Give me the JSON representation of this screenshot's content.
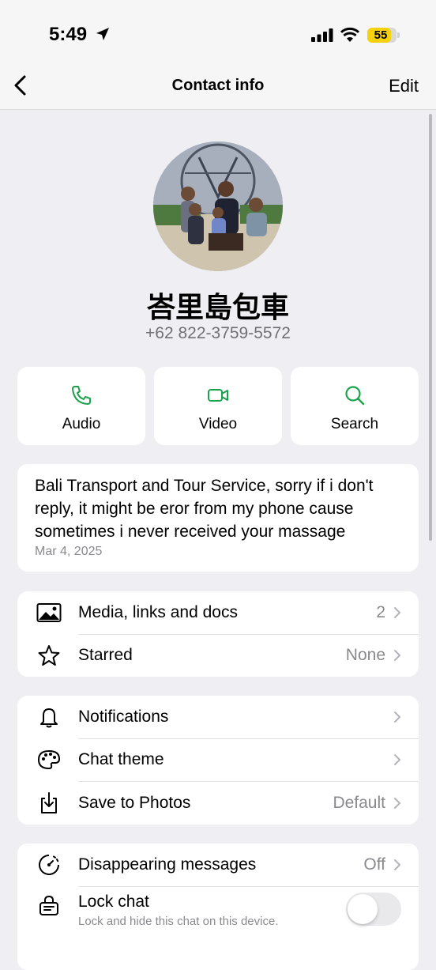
{
  "status_bar": {
    "time": "5:49",
    "battery": "55"
  },
  "nav": {
    "back_icon": "chevron-left-icon",
    "title": "Contact info",
    "edit_label": "Edit"
  },
  "contact": {
    "name": "峇里島包車",
    "phone": "+62 822-3759-5572"
  },
  "actions": [
    {
      "label": "Audio",
      "icon": "phone-icon"
    },
    {
      "label": "Video",
      "icon": "video-icon"
    },
    {
      "label": "Search",
      "icon": "search-icon"
    }
  ],
  "about": {
    "text": "Bali Transport and Tour Service, sorry if i don't reply, it might be eror from my phone cause sometimes i never received your massage",
    "date": "Mar 4, 2025"
  },
  "group1": [
    {
      "label": "Media, links and docs",
      "value": "2",
      "icon": "image-icon"
    },
    {
      "label": "Starred",
      "value": "None",
      "icon": "star-icon"
    }
  ],
  "group2": [
    {
      "label": "Notifications",
      "value": "",
      "icon": "bell-icon"
    },
    {
      "label": "Chat theme",
      "value": "",
      "icon": "palette-icon"
    },
    {
      "label": "Save to Photos",
      "value": "Default",
      "icon": "download-icon"
    }
  ],
  "group3": [
    {
      "label": "Disappearing messages",
      "value": "Off",
      "icon": "timer-icon"
    },
    {
      "label": "Lock chat",
      "sublabel": "Lock and hide this chat on this device.",
      "toggle": false,
      "icon": "lock-chat-icon"
    }
  ],
  "colors": {
    "accent": "#1aa34a",
    "background": "#efeff3",
    "card": "#ffffff",
    "secondary_text": "#8a8a8e"
  }
}
